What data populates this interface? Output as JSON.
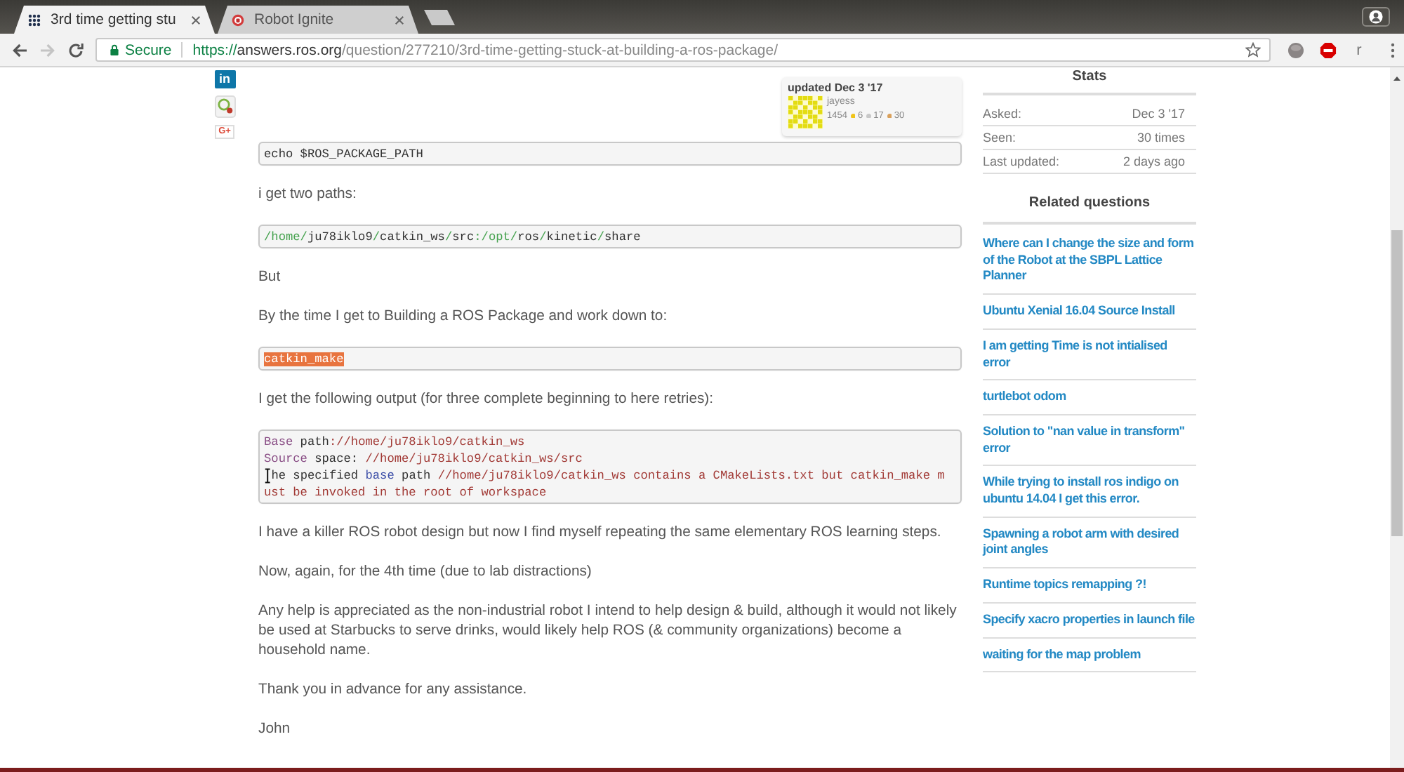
{
  "browser": {
    "tabs": [
      {
        "title": "3rd time getting stu",
        "kind": "ros",
        "selected": true
      },
      {
        "title": "Robot Ignite",
        "kind": "ignite",
        "selected": false
      }
    ],
    "nav_buttons": [
      {
        "kind": "back",
        "disabled": false
      },
      {
        "kind": "forward",
        "disabled": true
      },
      {
        "kind": "reload",
        "disabled": false
      }
    ],
    "address_bar": {
      "security_label": "Secure",
      "scheme": "https://",
      "host": "answers.ros.org",
      "path": "/question/277210/3rd-time-getting-stuck-at-building-a-ros-package/",
      "bookmarked": false
    },
    "extension_letter": "r"
  },
  "share_buttons": [
    {
      "kind": "linkedin",
      "label": "in"
    },
    {
      "kind": "magnifier"
    },
    {
      "kind": "googleplus",
      "label": "G+"
    }
  ],
  "post": {
    "updated_card": {
      "label": "updated Dec 3 '17",
      "user": "jayess",
      "karma": "1454",
      "badges": [
        {
          "count": "6",
          "color": "#f0c419"
        },
        {
          "count": "17",
          "color": "#c8c8c8"
        },
        {
          "count": "30",
          "color": "#d9a05b"
        }
      ]
    },
    "blocks": [
      {
        "kind": "code",
        "highlighted": false,
        "lines": [
          [
            {
              "kind": "plain",
              "text": "echo $ROS_PACKAGE_PATH"
            }
          ]
        ]
      },
      {
        "kind": "paragraph",
        "text": "i get two paths:"
      },
      {
        "kind": "code",
        "highlighted": false,
        "lines": [
          [
            {
              "kind": "path",
              "text": "/home/"
            },
            {
              "kind": "plain",
              "text": "ju78iklo9"
            },
            {
              "kind": "path",
              "text": "/"
            },
            {
              "kind": "plain",
              "text": "catkin_ws"
            },
            {
              "kind": "path",
              "text": "/"
            },
            {
              "kind": "plain",
              "text": "src"
            },
            {
              "kind": "path",
              "text": ":/opt/"
            },
            {
              "kind": "plain",
              "text": "ros"
            },
            {
              "kind": "path",
              "text": "/"
            },
            {
              "kind": "plain",
              "text": "kinetic"
            },
            {
              "kind": "path",
              "text": "/"
            },
            {
              "kind": "plain",
              "text": "share"
            }
          ]
        ]
      },
      {
        "kind": "paragraph",
        "text": "But"
      },
      {
        "kind": "paragraph",
        "text": "By the time I get to Building a ROS Package and work down to:"
      },
      {
        "kind": "code",
        "highlighted": true,
        "lines": [
          [
            {
              "kind": "plain",
              "text": "catkin_make"
            }
          ]
        ]
      },
      {
        "kind": "paragraph",
        "text": "I get the following output (for three complete beginning to here retries):"
      },
      {
        "kind": "code",
        "highlighted": false,
        "lines": [
          [
            {
              "kind": "keyword",
              "text": "Base"
            },
            {
              "kind": "plain",
              "text": " path"
            },
            {
              "kind": "literal",
              "text": "://home/ju78iklo9/catkin_ws"
            }
          ],
          [
            {
              "kind": "keyword",
              "text": "Source"
            },
            {
              "kind": "plain",
              "text": " space: "
            },
            {
              "kind": "literal",
              "text": "//home/ju78iklo9/catkin_ws/src"
            }
          ],
          [
            {
              "kind": "cursor"
            },
            {
              "kind": "plain",
              "text": "he specified "
            },
            {
              "kind": "name",
              "text": "base"
            },
            {
              "kind": "plain",
              "text": " path "
            },
            {
              "kind": "literal",
              "text": "//home/ju78iklo9/catkin_ws contains a CMakeLists.txt but catkin_make m"
            }
          ],
          [
            {
              "kind": "literal",
              "text": "ust be invoked in the root of workspace"
            }
          ]
        ]
      },
      {
        "kind": "paragraph",
        "text": "I have a killer ROS robot design but now I find myself repeating the same elementary ROS learning steps."
      },
      {
        "kind": "paragraph",
        "text": "Now, again, for the 4th time (due to lab distractions)"
      },
      {
        "kind": "paragraph",
        "text": "Any help is appreciated as the non-industrial robot I intend to help design & build, although it would not likely be used at Starbucks to serve drinks, would likely help ROS (& community organizations) become a household name."
      },
      {
        "kind": "paragraph",
        "text": "Thank you in advance for any assistance."
      },
      {
        "kind": "paragraph",
        "text": "John"
      }
    ]
  },
  "sidebar": {
    "stats_title": "Stats",
    "stats": [
      {
        "label": "Asked:",
        "value": "Dec 3 '17"
      },
      {
        "label": "Seen:",
        "value": "30 times"
      },
      {
        "label": "Last updated:",
        "value": "2 days ago"
      }
    ],
    "related_title": "Related questions",
    "related": [
      "Where can I change the size and form of the Robot at the SBPL Lattice Planner",
      "Ubuntu Xenial 16.04 Source Install",
      "I am getting Time is not intialised error",
      "turtlebot odom",
      "Solution to \"nan value in transform\" error",
      "While trying to install ros indigo on ubuntu 14.04 I get this error.",
      "Spawning a robot arm with desired joint angles",
      "Runtime topics remapping ?!",
      "Specify xacro properties in launch file",
      "waiting for the map problem"
    ]
  }
}
